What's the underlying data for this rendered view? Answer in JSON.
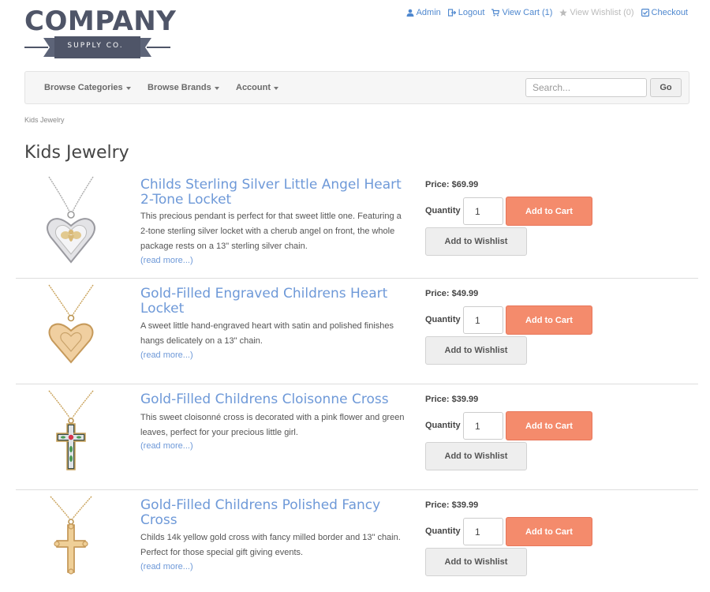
{
  "logo": {
    "word": "COMPANY",
    "sub": "SUPPLY CO."
  },
  "toplinks": [
    {
      "label": "Admin",
      "icon": "user-icon",
      "active": true
    },
    {
      "label": "Logout",
      "icon": "sign-out-icon",
      "active": true
    },
    {
      "label": "View Cart (1)",
      "icon": "cart-icon",
      "active": true
    },
    {
      "label": "View Wishlist (0)",
      "icon": "star-icon",
      "active": false
    },
    {
      "label": "Checkout",
      "icon": "check-square-icon",
      "active": true
    }
  ],
  "nav": {
    "categories": "Browse Categories",
    "brands": "Browse Brands",
    "account": "Account",
    "search_placeholder": "Search...",
    "go": "Go"
  },
  "breadcrumb": "Kids Jewelry",
  "page_title": "Kids Jewelry",
  "labels": {
    "quantity": "Quantity",
    "add_to_cart": "Add to Cart",
    "add_to_wishlist": "Add to Wishlist",
    "read_more": "(read more...)"
  },
  "products": [
    {
      "title": "Childs Sterling Silver Little Angel Heart 2-Tone Locket",
      "description": "This precious pendant is perfect for that sweet little one. Featuring a 2-tone sterling silver locket with a cherub angel on front, the whole package rests on a 13\" sterling silver chain.",
      "price": "Price: $69.99",
      "quantity": "1"
    },
    {
      "title": "Gold-Filled Engraved Childrens Heart Locket",
      "description": "A sweet little hand-engraved heart with satin and polished finishes hangs delicately on a 13\" chain.",
      "price": "Price: $49.99",
      "quantity": "1"
    },
    {
      "title": "Gold-Filled Childrens Cloisonne Cross",
      "description": "This sweet cloisonné cross is decorated with a pink flower and green leaves, perfect for your precious little girl.",
      "price": "Price: $39.99",
      "quantity": "1"
    },
    {
      "title": "Gold-Filled Childrens Polished Fancy Cross",
      "description": "Childs 14k yellow gold cross with fancy milled border and 13\" chain. Perfect for those special gift giving events.",
      "price": "Price: $39.99",
      "quantity": "1"
    }
  ],
  "colors": {
    "link": "#4f88cf",
    "title": "#6e99d8",
    "cart_button": "#f48b6c",
    "logo": "#4f5568"
  }
}
